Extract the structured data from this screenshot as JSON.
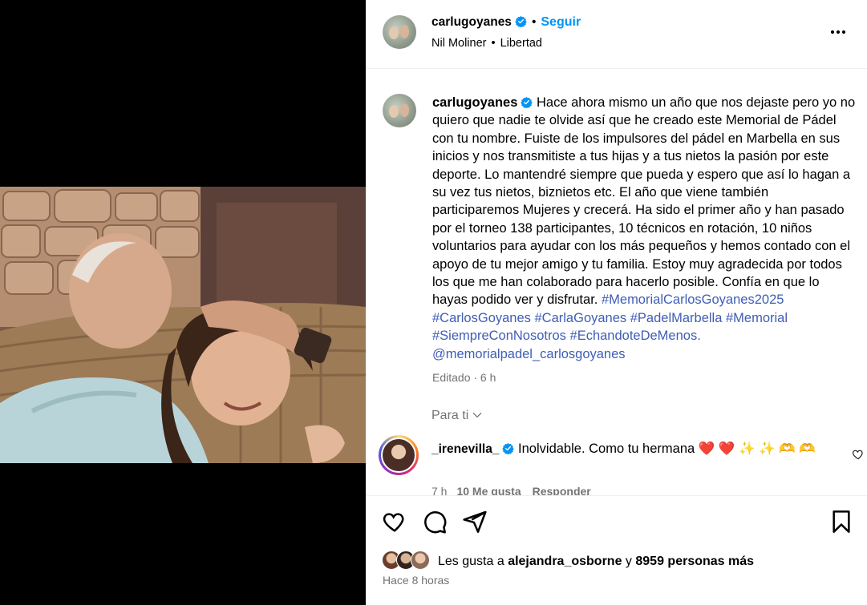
{
  "header": {
    "username": "carlugoyanes",
    "follow_label": "Seguir",
    "separator": "•",
    "audio_artist": "Nil Moliner",
    "audio_song": "Libertad"
  },
  "caption": {
    "username": "carlugoyanes",
    "text": "Hace ahora mismo un año que nos dejaste pero yo no quiero que nadie te olvide así que he creado este Memorial de Pádel con tu nombre. Fuiste de los impulsores del pádel en Marbella en sus inicios y nos transmitiste a tus hijas y a tus nietos la pasión por este deporte. Lo mantendré siempre que pueda y espero que así lo hagan a su vez tus nietos, biznietos etc. El año que viene también participaremos Mujeres y crecerá. Ha sido el primer año y han pasado por el torneo 138 participantes, 10 técnicos en rotación, 10 niños voluntarios para ayudar con los más pequeños y hemos contado con el apoyo de tu mejor amigo y tu familia. Estoy muy agradecida por todos los que me han colaborado para hacerlo posible. Confía en que lo hayas podido ver y disfrutar.",
    "hashtags": [
      "#MemorialCarlosGoyanes2025",
      "#CarlosGoyanes",
      "#CarlaGoyanes",
      "#PadelMarbella",
      "#Memorial",
      "#SiempreConNosotros",
      "#EchandoteDeMenos."
    ],
    "mention": "@memorialpadel_carlosgoyanes",
    "edited": "Editado · 6 h"
  },
  "suggestions": {
    "label": "Para ti"
  },
  "comment": {
    "username": "_irenevilla_",
    "text": "Inolvidable. Como tu hermana",
    "emojis": "❤️ ❤️ ✨ ✨ 🫶 🫶",
    "time": "7 h",
    "likes": "10 Me gusta",
    "reply": "Responder"
  },
  "actions": {
    "likes_prefix": "Les gusta a",
    "liked_by": "alejandra_osborne",
    "and": "y",
    "others": "8959 personas más",
    "posted": "Hace 8 horas"
  },
  "colors": {
    "link": "#0095f6",
    "hashtag": "#3f5eb5",
    "muted": "#737373",
    "verified": "#0095f6"
  },
  "icons": [
    "verified-icon",
    "more-options-icon",
    "chevron-down-icon",
    "heart-icon",
    "comment-icon",
    "share-icon",
    "bookmark-icon"
  ]
}
